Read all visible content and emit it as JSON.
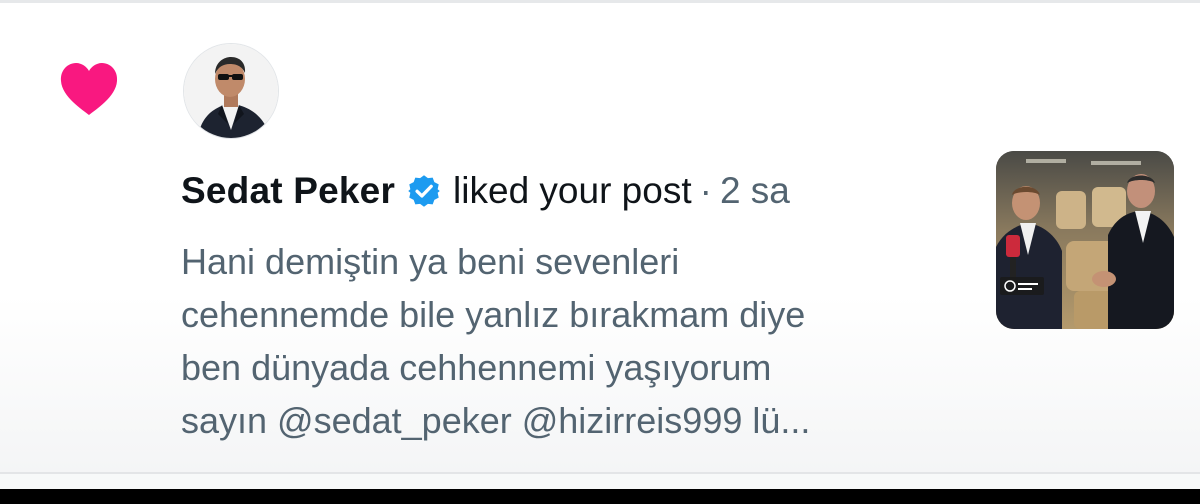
{
  "notification": {
    "type_icon": "heart-icon",
    "user": {
      "name": "Sedat Peker",
      "verified_icon": "verified-badge-icon",
      "avatar": "avatar-photo"
    },
    "action": "liked your post",
    "separator": "·",
    "time_ago": "2 sa",
    "post_text_lines": [
      "Hani demiştin ya beni sevenleri",
      "cehennemde bile yanlız bırakmam diye",
      "ben dünyada cehhennemi yaşıyorum",
      "sayın @sedat_peker @hizirreis999 lü..."
    ],
    "thumbnail": "post-media-thumbnail"
  },
  "colors": {
    "heart": "#f91880",
    "verified": "#1d9bf0",
    "primary_text": "#0f1419",
    "secondary_text": "#536471",
    "background": "#ffffff"
  }
}
